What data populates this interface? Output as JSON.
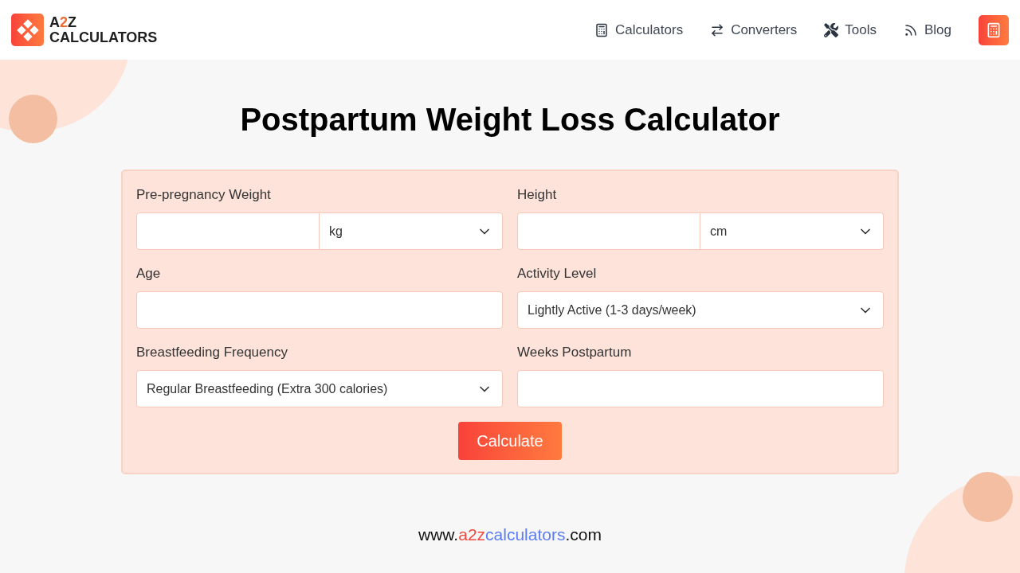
{
  "logo": {
    "parts": [
      {
        "text": "A",
        "color": "#1f1f1f"
      },
      {
        "text": "2",
        "color": "#f26a2e"
      },
      {
        "text": "Z",
        "color": "#1f1f1f"
      }
    ],
    "subtitle": "CALCULATORS"
  },
  "nav": [
    {
      "label": "Calculators",
      "kind": "calculator"
    },
    {
      "label": "Converters",
      "kind": "arrows"
    },
    {
      "label": "Tools",
      "kind": "tools"
    },
    {
      "label": "Blog",
      "kind": "blog"
    }
  ],
  "title": "Postpartum Weight Loss Calculator",
  "fields": [
    {
      "label": "Pre-pregnancy Weight",
      "kind": "unit",
      "unit": "kg"
    },
    {
      "label": "Height",
      "kind": "unit",
      "unit": "cm"
    },
    {
      "label": "Age",
      "kind": "text"
    },
    {
      "label": "Activity Level",
      "kind": "select",
      "value": "Lightly Active (1-3 days/week)"
    },
    {
      "label": "Breastfeeding Frequency",
      "kind": "select",
      "value": "Regular Breastfeeding (Extra 300 calories)"
    },
    {
      "label": "Weeks Postpartum",
      "kind": "text"
    }
  ],
  "button": "Calculate",
  "footer": [
    {
      "text": "www.",
      "color": "#111111"
    },
    {
      "text": "a2z",
      "color": "#f0483e"
    },
    {
      "text": "calculators",
      "color": "#5b7cf7"
    },
    {
      "text": ".com",
      "color": "#111111"
    }
  ]
}
